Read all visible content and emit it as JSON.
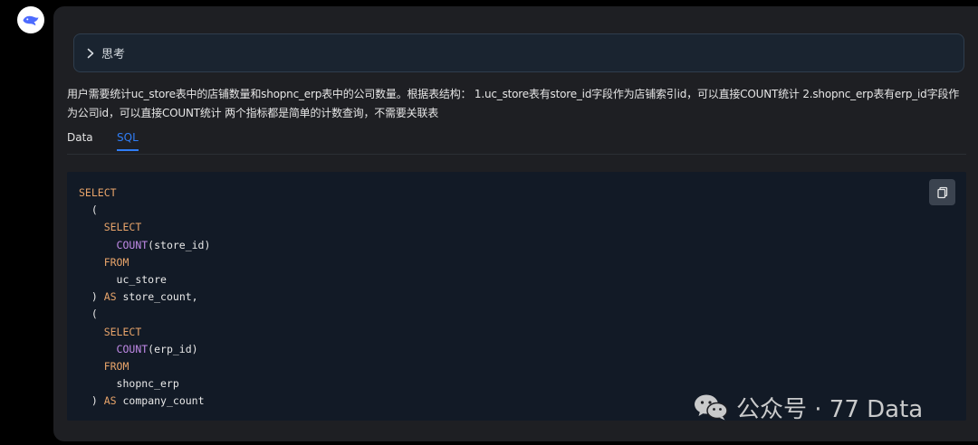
{
  "thinking": {
    "label": "思考"
  },
  "description": "用户需要统计uc_store表中的店铺数量和shopnc_erp表中的公司数量。根据表结构： 1.uc_store表有store_id字段作为店铺索引id，可以直接COUNT统计 2.shopnc_erp表有erp_id字段作为公司id，可以直接COUNT统计 两个指标都是简单的计数查询，不需要关联表",
  "tabs": [
    {
      "label": "Data",
      "active": false
    },
    {
      "label": "SQL",
      "active": true
    }
  ],
  "code_lines": [
    {
      "indent": "",
      "tokens": [
        {
          "t": "SELECT",
          "c": "kw"
        }
      ]
    },
    {
      "indent": "  ",
      "tokens": [
        {
          "t": "(",
          "c": ""
        }
      ]
    },
    {
      "indent": "    ",
      "tokens": [
        {
          "t": "SELECT",
          "c": "kw"
        }
      ]
    },
    {
      "indent": "      ",
      "tokens": [
        {
          "t": "COUNT",
          "c": "fn"
        },
        {
          "t": "(store_id)",
          "c": ""
        }
      ]
    },
    {
      "indent": "    ",
      "tokens": [
        {
          "t": "FROM",
          "c": "kw"
        }
      ]
    },
    {
      "indent": "      ",
      "tokens": [
        {
          "t": "uc_store",
          "c": ""
        }
      ]
    },
    {
      "indent": "  ",
      "tokens": [
        {
          "t": ") ",
          "c": ""
        },
        {
          "t": "AS",
          "c": "kw"
        },
        {
          "t": " store_count,",
          "c": ""
        }
      ]
    },
    {
      "indent": "  ",
      "tokens": [
        {
          "t": "(",
          "c": ""
        }
      ]
    },
    {
      "indent": "    ",
      "tokens": [
        {
          "t": "SELECT",
          "c": "kw"
        }
      ]
    },
    {
      "indent": "      ",
      "tokens": [
        {
          "t": "COUNT",
          "c": "fn"
        },
        {
          "t": "(erp_id)",
          "c": ""
        }
      ]
    },
    {
      "indent": "    ",
      "tokens": [
        {
          "t": "FROM",
          "c": "kw"
        }
      ]
    },
    {
      "indent": "      ",
      "tokens": [
        {
          "t": "shopnc_erp",
          "c": ""
        }
      ]
    },
    {
      "indent": "  ",
      "tokens": [
        {
          "t": ") ",
          "c": ""
        },
        {
          "t": "AS",
          "c": "kw"
        },
        {
          "t": " company_count",
          "c": ""
        }
      ]
    }
  ],
  "watermark": {
    "text": "公众号 · 77 Data"
  },
  "icons": {
    "avatar": "whale-logo-icon",
    "chevron": "chevron-right-icon",
    "copy": "copy-icon",
    "wechat": "wechat-icon"
  },
  "colors": {
    "accent": "#2f7df6",
    "keyword": "#e8a46a",
    "function": "#c18ae8"
  }
}
